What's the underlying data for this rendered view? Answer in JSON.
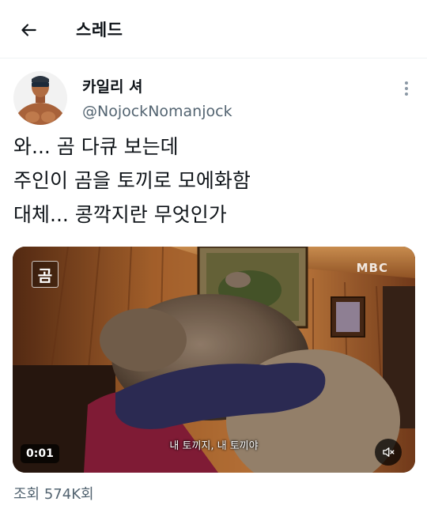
{
  "header": {
    "title": "스레드"
  },
  "tweet": {
    "author_name": "카일리 셔",
    "author_handle": "@NojockNomanjock",
    "text_lines": [
      "와... 곰 다큐 보는데",
      "주인이 곰을 토끼로 모에화함",
      "대체... 콩깍지란 무엇인가"
    ],
    "media": {
      "logo_char": "곰",
      "channel_logo": "MBC",
      "subtitle": "내 토끼지, 내 토끼야",
      "timestamp": "0:01",
      "mute_icon": "muted-speaker-icon"
    },
    "views_label": "조회",
    "views_count": "574K회"
  },
  "colors": {
    "text": "#0f1419",
    "secondary": "#536471",
    "divider": "#eff3f4"
  }
}
